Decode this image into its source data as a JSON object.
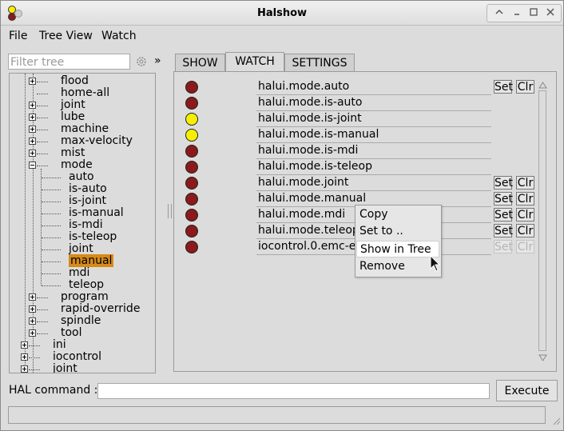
{
  "window": {
    "title": "Halshow"
  },
  "menu": [
    "File",
    "Tree View",
    "Watch"
  ],
  "filter": {
    "placeholder": "Filter tree",
    "expand_label": "»"
  },
  "tree": {
    "items": [
      {
        "label": "flood",
        "level": 2,
        "expander": "plus"
      },
      {
        "label": "home-all",
        "level": 2,
        "expander": "none"
      },
      {
        "label": "joint",
        "level": 2,
        "expander": "plus"
      },
      {
        "label": "lube",
        "level": 2,
        "expander": "plus"
      },
      {
        "label": "machine",
        "level": 2,
        "expander": "plus"
      },
      {
        "label": "max-velocity",
        "level": 2,
        "expander": "plus"
      },
      {
        "label": "mist",
        "level": 2,
        "expander": "plus"
      },
      {
        "label": "mode",
        "level": 2,
        "expander": "minus"
      },
      {
        "label": "auto",
        "level": 3,
        "expander": "none"
      },
      {
        "label": "is-auto",
        "level": 3,
        "expander": "none"
      },
      {
        "label": "is-joint",
        "level": 3,
        "expander": "none"
      },
      {
        "label": "is-manual",
        "level": 3,
        "expander": "none"
      },
      {
        "label": "is-mdi",
        "level": 3,
        "expander": "none"
      },
      {
        "label": "is-teleop",
        "level": 3,
        "expander": "none"
      },
      {
        "label": "joint",
        "level": 3,
        "expander": "none"
      },
      {
        "label": "manual",
        "level": 3,
        "expander": "none",
        "selected": true
      },
      {
        "label": "mdi",
        "level": 3,
        "expander": "none"
      },
      {
        "label": "teleop",
        "level": 3,
        "expander": "none"
      },
      {
        "label": "program",
        "level": 2,
        "expander": "plus"
      },
      {
        "label": "rapid-override",
        "level": 2,
        "expander": "plus"
      },
      {
        "label": "spindle",
        "level": 2,
        "expander": "plus"
      },
      {
        "label": "tool",
        "level": 2,
        "expander": "plus"
      },
      {
        "label": "ini",
        "level": 1,
        "expander": "plus"
      },
      {
        "label": "iocontrol",
        "level": 1,
        "expander": "plus"
      },
      {
        "label": "joint",
        "level": 1,
        "expander": "plus"
      }
    ],
    "selected_color": "#d68a19"
  },
  "tabs": [
    {
      "label": "SHOW",
      "active": false
    },
    {
      "label": "WATCH",
      "active": true
    },
    {
      "label": "SETTINGS",
      "active": false
    }
  ],
  "watch": {
    "set_label": "Set",
    "clr_label": "Clr",
    "rows": [
      {
        "signal": "halui.mode.auto",
        "state": "off",
        "buttons": "enabled"
      },
      {
        "signal": "halui.mode.is-auto",
        "state": "off",
        "buttons": "none"
      },
      {
        "signal": "halui.mode.is-joint",
        "state": "on",
        "buttons": "none"
      },
      {
        "signal": "halui.mode.is-manual",
        "state": "on",
        "buttons": "none"
      },
      {
        "signal": "halui.mode.is-mdi",
        "state": "off",
        "buttons": "none"
      },
      {
        "signal": "halui.mode.is-teleop",
        "state": "off",
        "buttons": "none"
      },
      {
        "signal": "halui.mode.joint",
        "state": "off",
        "buttons": "enabled"
      },
      {
        "signal": "halui.mode.manual",
        "state": "off",
        "buttons": "enabled"
      },
      {
        "signal": "halui.mode.mdi",
        "state": "off",
        "buttons": "enabled"
      },
      {
        "signal": "halui.mode.teleop",
        "state": "off",
        "buttons": "enabled"
      },
      {
        "signal": "iocontrol.0.emc-en",
        "state": "off",
        "buttons": "disabled"
      }
    ],
    "colors": {
      "off": "#8b1a1a",
      "on": "#f5f000"
    }
  },
  "context_menu": {
    "items": [
      "Copy",
      "Set to ..",
      "Show in Tree",
      "Remove"
    ],
    "highlighted": "Show in Tree"
  },
  "hal": {
    "label": "HAL command :",
    "value": "",
    "execute_label": "Execute"
  },
  "status": {
    "text": ""
  }
}
